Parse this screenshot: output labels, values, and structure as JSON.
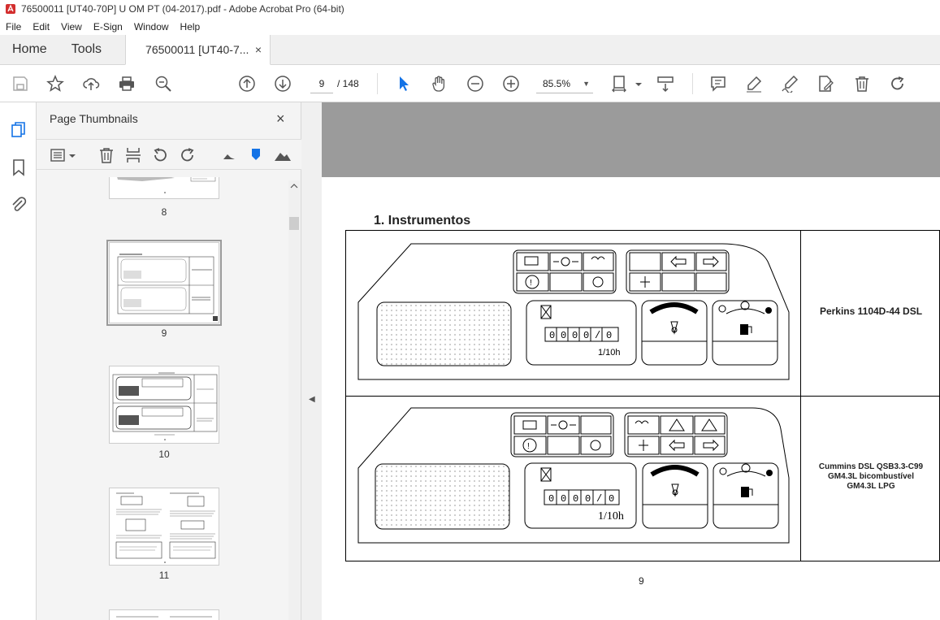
{
  "window": {
    "title": "76500011 [UT40-70P] U OM PT (04-2017).pdf - Adobe Acrobat Pro (64-bit)"
  },
  "menu": [
    "File",
    "Edit",
    "View",
    "E-Sign",
    "Window",
    "Help"
  ],
  "tabs": {
    "home": "Home",
    "tools": "Tools",
    "document": "76500011 [UT40-7...",
    "close": "×"
  },
  "toolbar": {
    "current_page": "9",
    "total_pages": "/ 148",
    "zoom": "85.5%",
    "icons": [
      "save-icon",
      "star-icon",
      "upload-icon",
      "print-icon",
      "zoom-search-icon",
      "page-up-icon",
      "page-down-icon",
      "select-arrow-icon",
      "hand-icon",
      "zoom-out-icon",
      "zoom-in-icon",
      "fit-page-icon",
      "scroll-mode-icon",
      "comment-icon",
      "highlight-icon",
      "sign-icon",
      "edit-pdf-icon",
      "delete-icon",
      "redo-icon"
    ]
  },
  "sidebar": {
    "title": "Page Thumbnails",
    "close": "×",
    "thumbnails": [
      {
        "label": "8"
      },
      {
        "label": "9"
      },
      {
        "label": "10"
      },
      {
        "label": "11"
      }
    ]
  },
  "document": {
    "heading": "1. Instrumentos",
    "row1_label": "Perkins 1104D-44 DSL",
    "row2_label_lines": [
      "Cummins DSL QSB3.3-C99",
      "GM4.3L bicombustível",
      "GM4.3L LPG"
    ],
    "hour_meter_unit": "1/10h",
    "page_number": "9"
  }
}
